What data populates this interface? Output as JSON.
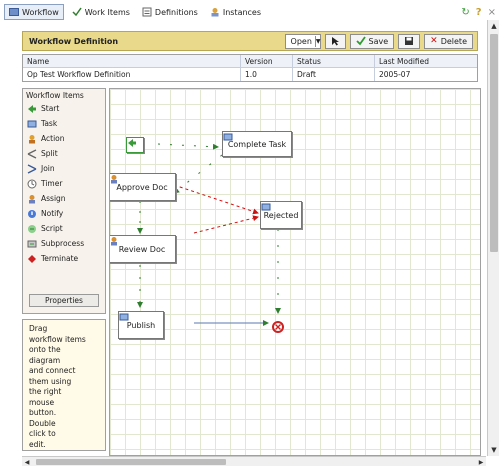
{
  "tabs": [
    {
      "label": "Workflow",
      "icon": "workflow-icon"
    },
    {
      "label": "Work Items",
      "icon": "checklist-icon"
    },
    {
      "label": "Definitions",
      "icon": "definitions-icon"
    },
    {
      "label": "Instances",
      "icon": "instances-icon"
    }
  ],
  "toolbar": {
    "title": "Workflow Definition",
    "select_value": "Open",
    "save_label": "Save",
    "delete_label": "Delete"
  },
  "grid": {
    "headers": [
      "Name",
      "Version",
      "Status",
      "Last Modified"
    ],
    "rows": [
      [
        "Op Test Workflow Definition",
        "1.0",
        "Draft",
        "2005-07"
      ]
    ]
  },
  "palette": {
    "title": "Workflow Items",
    "items": [
      {
        "label": "Start",
        "icon": "start-icon"
      },
      {
        "label": "Task",
        "icon": "task-icon"
      },
      {
        "label": "Action",
        "icon": "action-icon"
      },
      {
        "label": "Split",
        "icon": "split-icon"
      },
      {
        "label": "Join",
        "icon": "join-icon"
      },
      {
        "label": "Timer",
        "icon": "timer-icon"
      },
      {
        "label": "Assign",
        "icon": "assign-icon"
      },
      {
        "label": "Notify",
        "icon": "notify-icon"
      },
      {
        "label": "Script",
        "icon": "script-icon"
      },
      {
        "label": "Subprocess",
        "icon": "subprocess-icon"
      },
      {
        "label": "Terminate",
        "icon": "terminate-icon"
      }
    ],
    "footer_button": "Properties"
  },
  "help": {
    "lines": [
      "Drag",
      "workflow items",
      "onto the",
      "diagram",
      "and connect",
      "them using",
      "the right",
      "mouse",
      "button.",
      "Double",
      "click to",
      "edit."
    ]
  },
  "diagram": {
    "nodes": [
      {
        "id": "start",
        "label": ""
      },
      {
        "id": "complete",
        "label": "Complete Task"
      },
      {
        "id": "approve",
        "label": "Approve Doc"
      },
      {
        "id": "rejected",
        "label": "Rejected"
      },
      {
        "id": "review",
        "label": "Review Doc"
      },
      {
        "id": "publish",
        "label": "Publish"
      }
    ],
    "edge_color_normal": "#2f7d2f",
    "edge_color_reject": "#cc1111"
  },
  "colors": {
    "toolbar_bg": "#e9d98a",
    "grid_line": "#e1e8cf",
    "end_node": "#cc2222"
  }
}
